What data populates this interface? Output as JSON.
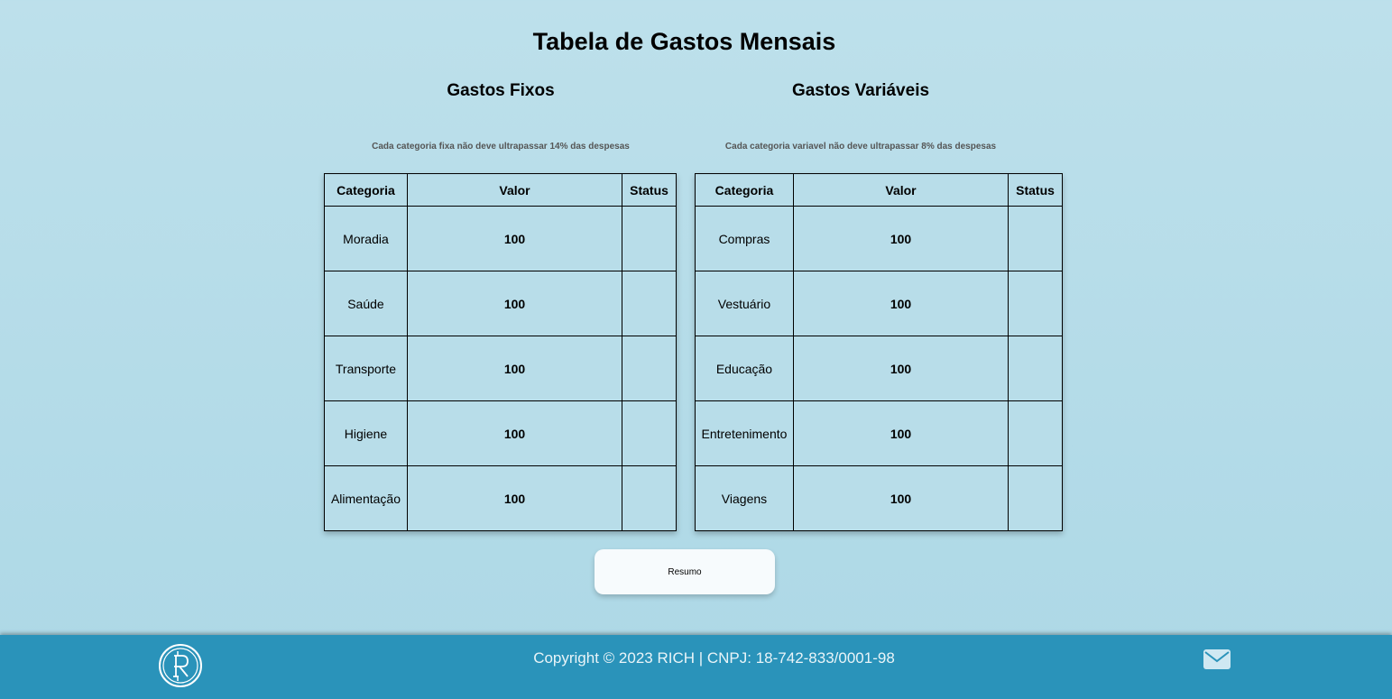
{
  "page": {
    "title": "Tabela de Gastos Mensais"
  },
  "fixed": {
    "title": "Gastos Fixos",
    "note": "Cada categoria fixa não deve ultrapassar 14% das despesas",
    "headers": {
      "category": "Categoria",
      "value": "Valor",
      "status": "Status"
    },
    "rows": [
      {
        "category": "Moradia",
        "value": "100",
        "status": ""
      },
      {
        "category": "Saúde",
        "value": "100",
        "status": ""
      },
      {
        "category": "Transporte",
        "value": "100",
        "status": ""
      },
      {
        "category": "Higiene",
        "value": "100",
        "status": ""
      },
      {
        "category": "Alimentação",
        "value": "100",
        "status": ""
      }
    ]
  },
  "variable": {
    "title": "Gastos Variáveis",
    "note": "Cada categoria variavel não deve ultrapassar 8% das despesas",
    "headers": {
      "category": "Categoria",
      "value": "Valor",
      "status": "Status"
    },
    "rows": [
      {
        "category": "Compras",
        "value": "100",
        "status": ""
      },
      {
        "category": "Vestuário",
        "value": "100",
        "status": ""
      },
      {
        "category": "Educação",
        "value": "100",
        "status": ""
      },
      {
        "category": "Entretenimento",
        "value": "100",
        "status": ""
      },
      {
        "category": "Viagens",
        "value": "100",
        "status": ""
      }
    ]
  },
  "actions": {
    "summary_label": "Resumo"
  },
  "footer": {
    "copyright": "Copyright © 2023 RICH | CNPJ: 18-742-833/0001-98",
    "logo_icon": "rich-logo-icon",
    "mail_icon": "mail-icon"
  },
  "colors": {
    "background": "#bde0eb",
    "table_background": "#b8dde9",
    "footer_background": "#2a93ba",
    "button_background": "#f7fbfd"
  }
}
